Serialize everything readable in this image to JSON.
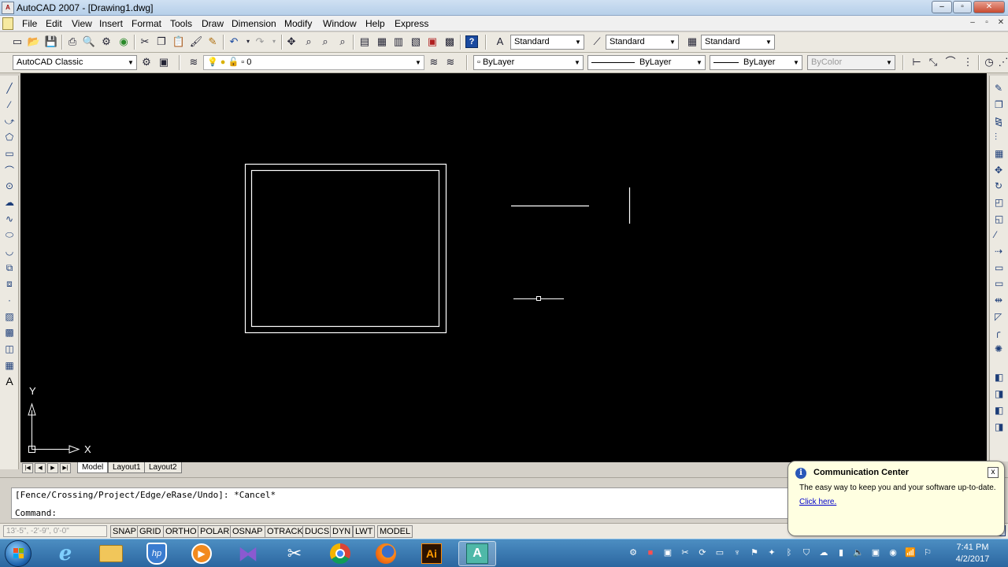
{
  "window": {
    "title": "AutoCAD 2007 - [Drawing1.dwg]",
    "app_icon_label": "A",
    "controls": [
      "–",
      "▫",
      "✕"
    ],
    "mdi_controls": [
      "–",
      "▫",
      "✕"
    ]
  },
  "menubar": {
    "items": [
      "File",
      "Edit",
      "View",
      "Insert",
      "Format",
      "Tools",
      "Draw",
      "Dimension",
      "Modify",
      "Window",
      "Help",
      "Express"
    ]
  },
  "standard_toolbar": {
    "text_style": "Standard",
    "dim_style": "Standard",
    "table_style": "Standard"
  },
  "workspace_toolbar": {
    "workspace": "AutoCAD Classic",
    "layer": "0",
    "color": "ByLayer",
    "linetype": "ByLayer",
    "lineweight": "ByLayer",
    "plot_style": "ByColor"
  },
  "draw_toolbar_icons": [
    "line-icon",
    "construction-line-icon",
    "polyline-icon",
    "polygon-icon",
    "rectangle-icon",
    "arc-icon",
    "circle-icon",
    "revision-cloud-icon",
    "spline-icon",
    "ellipse-icon",
    "ellipse-arc-icon",
    "insert-block-icon",
    "make-block-icon",
    "point-icon",
    "hatch-icon",
    "gradient-icon",
    "region-icon",
    "table-icon",
    "multiline-text-icon"
  ],
  "modify_toolbar_icons": [
    "erase-icon",
    "copy-icon",
    "mirror-icon",
    "offset-icon",
    "array-icon",
    "move-icon",
    "rotate-icon",
    "scale-icon",
    "stretch-icon",
    "trim-icon",
    "extend-icon",
    "break-at-point-icon",
    "break-icon",
    "join-icon",
    "chamfer-icon",
    "fillet-icon",
    "explode-icon"
  ],
  "ucs": {
    "x_label": "X",
    "y_label": "Y"
  },
  "layout_tabs": [
    "Model",
    "Layout1",
    "Layout2"
  ],
  "active_tab": "Model",
  "command_window": {
    "history": "[Fence/Crossing/Project/Edge/eRase/Undo]: *Cancel*",
    "prompt": "Command:"
  },
  "statusbar": {
    "coordinates": "13'-5\", -2'-9\", 0'-0\"",
    "buttons": [
      "SNAP",
      "GRID",
      "ORTHO",
      "POLAR",
      "OSNAP",
      "OTRACK",
      "DUCS",
      "DYN",
      "LWT",
      "MODEL"
    ]
  },
  "communication_center": {
    "title": "Communication Center",
    "message": "The easy way to keep you and your software up-to-date.",
    "link": "Click here.",
    "close": "x"
  },
  "taskbar": {
    "apps": [
      "internet-explorer-icon",
      "file-explorer-icon",
      "hp-support-icon",
      "media-player-icon",
      "visual-studio-icon",
      "snipping-tool-icon",
      "chrome-icon",
      "firefox-icon",
      "illustrator-icon",
      "autocad-icon"
    ],
    "illustrator_label": "Ai",
    "time": "7:41 PM",
    "date": "4/2/2017"
  },
  "colors": {
    "drawing_background": "#000000",
    "drawing_lines": "#ffffff",
    "taskbar": "#2b66a0",
    "balloon": "#ffffe1"
  }
}
